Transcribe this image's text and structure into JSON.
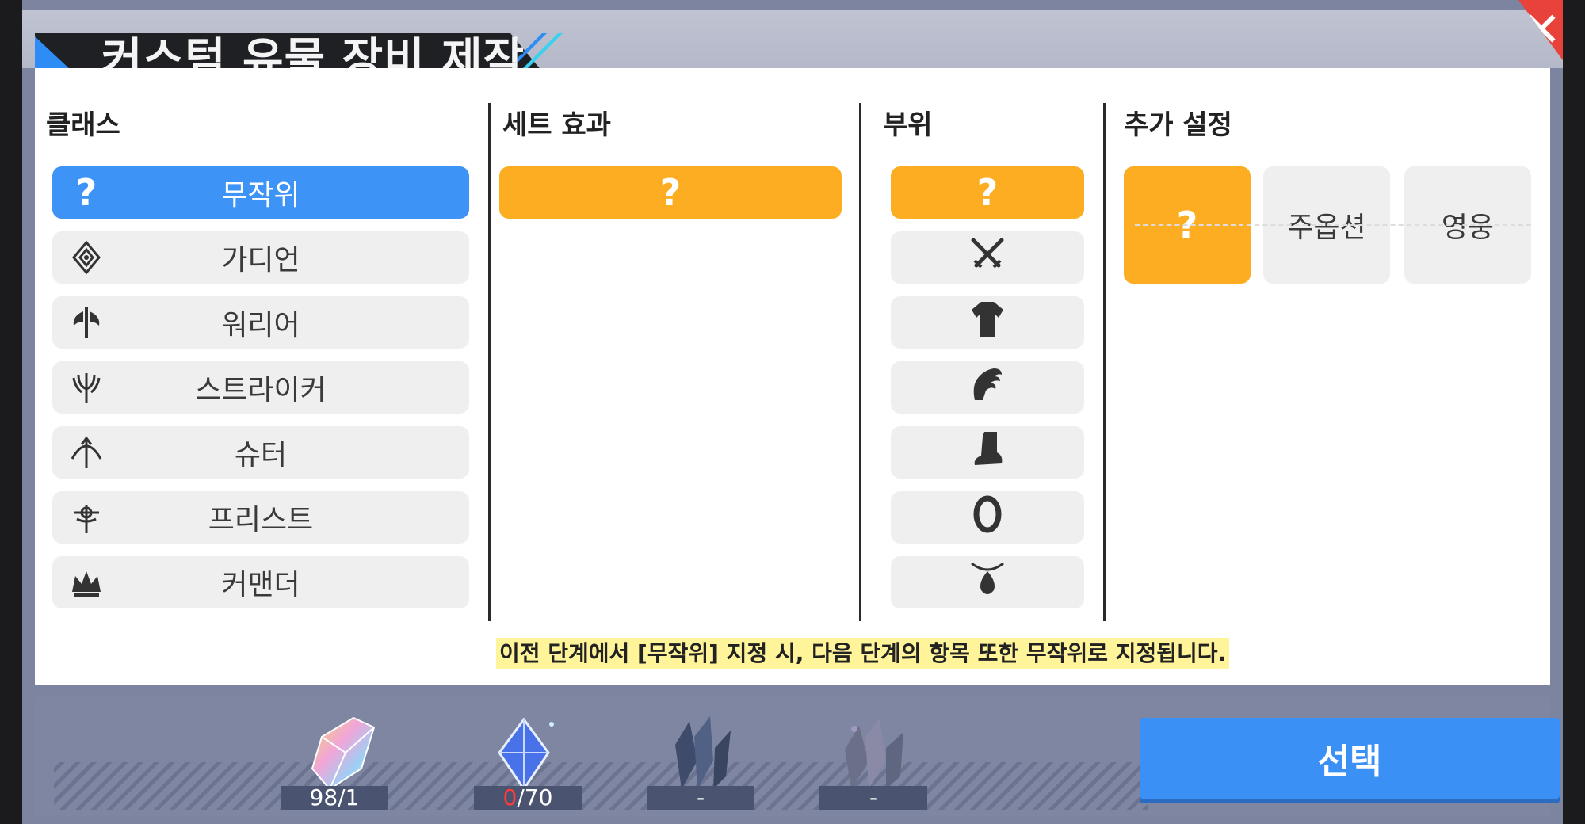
{
  "title": "커스텀 유물 장비 제작",
  "close_label": "✕",
  "columns": {
    "class": {
      "label": "클래스",
      "items": [
        {
          "label": "무작위",
          "icon": "question-icon",
          "selected": true
        },
        {
          "label": "가디언",
          "icon": "guardian-emblem-icon"
        },
        {
          "label": "워리어",
          "icon": "warrior-axe-icon"
        },
        {
          "label": "스트라이커",
          "icon": "striker-trident-icon"
        },
        {
          "label": "슈터",
          "icon": "shooter-bow-icon"
        },
        {
          "label": "프리스트",
          "icon": "priest-cross-icon"
        },
        {
          "label": "커맨더",
          "icon": "commander-crown-icon"
        }
      ]
    },
    "set_effect": {
      "label": "세트 효과",
      "items": [
        {
          "label": "?",
          "selected": true
        }
      ]
    },
    "part": {
      "label": "부위",
      "items": [
        {
          "label": "?",
          "selected": true
        },
        {
          "icon": "crossed-swords-icon"
        },
        {
          "icon": "armor-tunic-icon"
        },
        {
          "icon": "gauntlet-icon"
        },
        {
          "icon": "boot-icon"
        },
        {
          "icon": "ring-icon"
        },
        {
          "icon": "necklace-pendant-icon"
        }
      ]
    },
    "extra": {
      "label": "추가 설정",
      "items": [
        {
          "label": "?",
          "selected": true
        },
        {
          "label": "주옵션"
        },
        {
          "label": "영웅"
        }
      ]
    }
  },
  "notice": "이전 단계에서 [무작위] 지정 시, 다음 단계의 항목 또한 무작위로 지정됩니다.",
  "resources": [
    {
      "icon": "rainbow-crystal-icon",
      "value": "98/1"
    },
    {
      "icon": "blue-gem-icon",
      "value_current": "0",
      "value_max": "/70"
    },
    {
      "icon": "dark-crystal-cluster-icon",
      "value": "-"
    },
    {
      "icon": "prismatic-crystal-cluster-icon",
      "value": "-"
    }
  ],
  "select_button": "선택",
  "colors": {
    "blue": "#3d93f6",
    "orange": "#fcad21",
    "close": "#e8423a"
  }
}
